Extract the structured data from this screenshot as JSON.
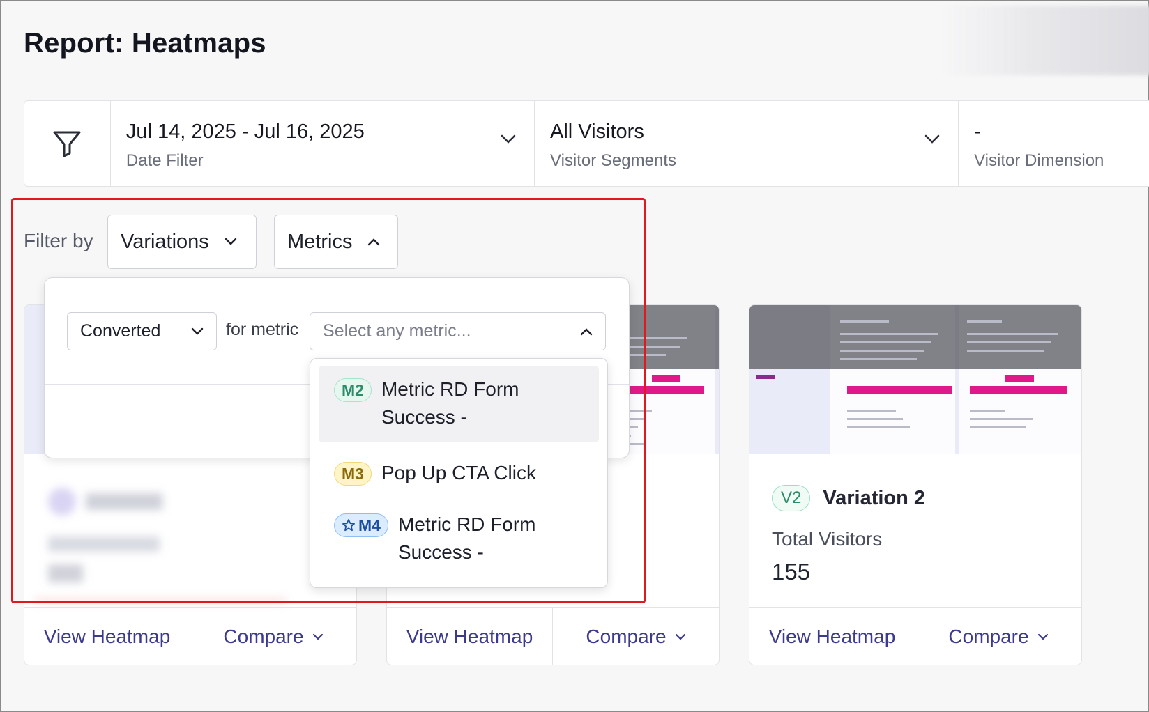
{
  "header": {
    "title": "Report: Heatmaps"
  },
  "filter_bar": {
    "date": {
      "value": "Jul 14, 2025 - Jul 16, 2025",
      "label": "Date Filter"
    },
    "segments": {
      "value": "All Visitors",
      "label": "Visitor Segments"
    },
    "dimension": {
      "value": "-",
      "label": "Visitor Dimension"
    }
  },
  "filter_by": {
    "label": "Filter by",
    "variations_label": "Variations",
    "metrics_label": "Metrics"
  },
  "metric_filter": {
    "condition_value": "Converted",
    "for_metric_label": "for metric",
    "metric_placeholder": "Select any metric...",
    "options": [
      {
        "badge": "M2",
        "label": "Metric RD Form Success -",
        "starred": false
      },
      {
        "badge": "M3",
        "label": "Pop Up CTA Click",
        "starred": false
      },
      {
        "badge": "M4",
        "label": "Metric RD Form Success -",
        "starred": true
      }
    ]
  },
  "cards": [
    {
      "view_label": "View Heatmap",
      "compare_label": "Compare"
    },
    {
      "view_label": "View Heatmap",
      "compare_label": "Compare"
    },
    {
      "badge": "V2",
      "name": "Variation 2",
      "visitors_label": "Total Visitors",
      "visitors_value": "155",
      "view_label": "View Heatmap",
      "compare_label": "Compare"
    }
  ],
  "colors": {
    "accent": "#3c3a8c",
    "highlight": "#e0191e",
    "brand_pink": "#e0198a"
  }
}
